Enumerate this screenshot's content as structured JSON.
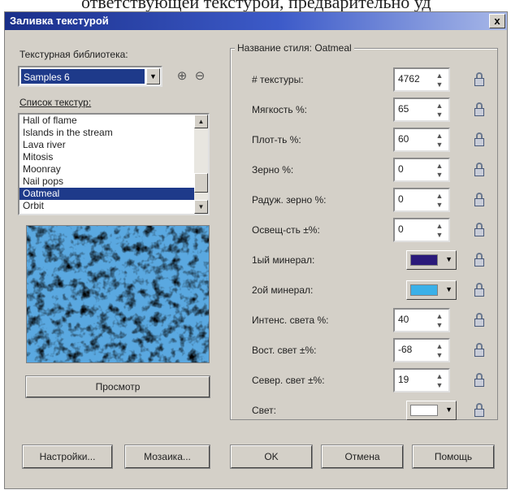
{
  "top_text": "ответствующей текстурой, предварительно уд",
  "title": "Заливка текстурой",
  "close_glyph": "x",
  "library_label": "Текстурная библиотека:",
  "library_value": "Samples 6",
  "texture_list_label": "Список текстур:",
  "textures": [
    {
      "name": "Hall of flame",
      "selected": false
    },
    {
      "name": "Islands in the stream",
      "selected": false
    },
    {
      "name": "Lava river",
      "selected": false
    },
    {
      "name": "Mitosis",
      "selected": false
    },
    {
      "name": "Moonray",
      "selected": false
    },
    {
      "name": "Nail pops",
      "selected": false
    },
    {
      "name": "Oatmeal",
      "selected": true
    },
    {
      "name": "Orbit",
      "selected": false
    }
  ],
  "preview_button": "Просмотр",
  "style_name_label": "Название стиля: Oatmeal",
  "params": [
    {
      "label": "# текстуры:",
      "value": "4762",
      "type": "spin"
    },
    {
      "label": "Мягкость %:",
      "value": "65",
      "type": "spin"
    },
    {
      "label": "Плот-ть %:",
      "value": "60",
      "type": "spin"
    },
    {
      "label": "Зерно %:",
      "value": "0",
      "type": "spin"
    },
    {
      "label": "Радуж. зерно %:",
      "value": "0",
      "type": "spin"
    },
    {
      "label": "Освещ-сть ±%:",
      "value": "0",
      "type": "spin"
    },
    {
      "label": "1ый минерал:",
      "color": "#2a1a7a",
      "type": "color"
    },
    {
      "label": "2ой минерал:",
      "color": "#3ab0e8",
      "type": "color"
    },
    {
      "label": "Интенс. света %:",
      "value": "40",
      "type": "spin"
    },
    {
      "label": "Вост. свет ±%:",
      "value": "-68",
      "type": "spin"
    },
    {
      "label": "Север. свет ±%:",
      "value": "19",
      "type": "spin"
    },
    {
      "label": "Свет:",
      "color": "#ffffff",
      "type": "color"
    }
  ],
  "buttons": {
    "settings": "Настройки...",
    "mosaic": "Мозаика...",
    "ok": "OK",
    "cancel": "Отмена",
    "help": "Помощь"
  },
  "colors": {
    "selection": "#1e3a8a",
    "texture_light": "#5aa8e0",
    "texture_dark": "#4a3a90"
  }
}
